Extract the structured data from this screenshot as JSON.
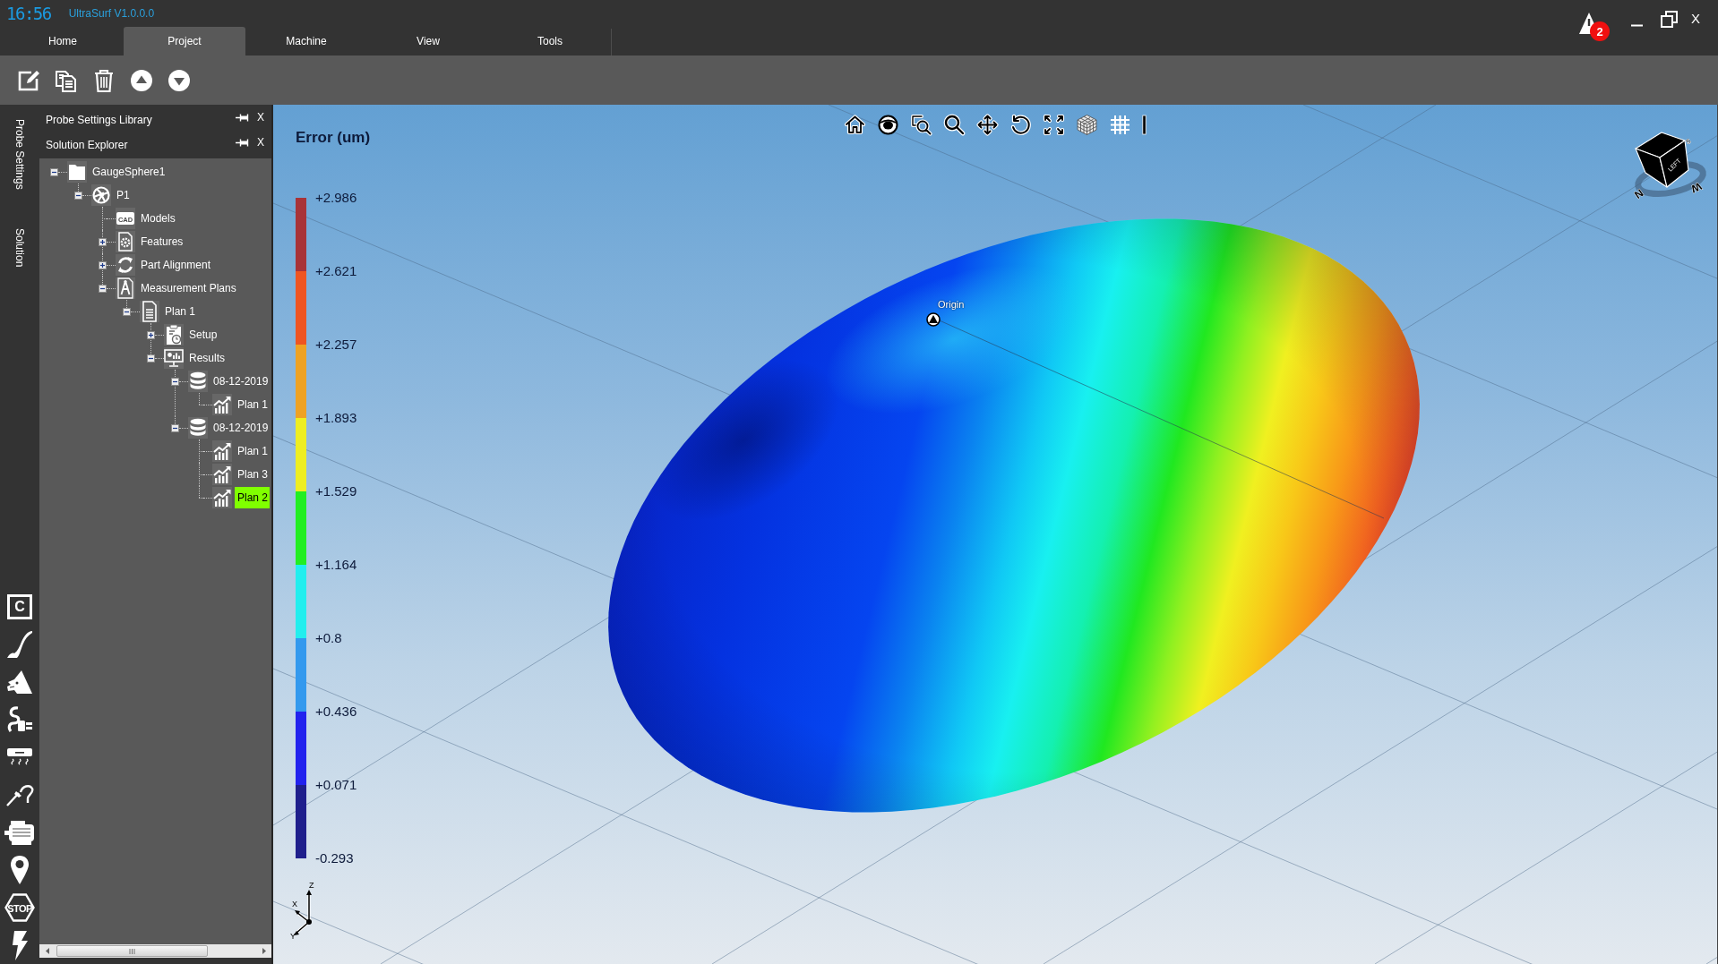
{
  "title_bar": {
    "clock": "16:56",
    "app_name": "UltraSurf V1.0.0.0",
    "alert_count": "2",
    "close_label": "X"
  },
  "ribbon_tabs": [
    {
      "label": "Home",
      "selected": false
    },
    {
      "label": "Project",
      "selected": true
    },
    {
      "label": "Machine",
      "selected": false
    },
    {
      "label": "View",
      "selected": false
    },
    {
      "label": "Tools",
      "selected": false
    }
  ],
  "side_tabs": [
    "Probe Settings",
    "Solution"
  ],
  "tool_strip": [
    {
      "kind": "letter",
      "label": "C"
    },
    {
      "kind": "brush"
    },
    {
      "kind": "wolf"
    },
    {
      "kind": "plug"
    },
    {
      "kind": "heater"
    },
    {
      "kind": "probe"
    },
    {
      "kind": "motor"
    },
    {
      "kind": "pin"
    },
    {
      "kind": "stop",
      "label": "STOP"
    },
    {
      "kind": "bolt"
    }
  ],
  "dock_panels": [
    {
      "title": "Probe Settings Library",
      "close_label": "X"
    },
    {
      "title": "Solution Explorer",
      "close_label": "X"
    }
  ],
  "solution_tree": [
    {
      "label": "GaugeSphere1",
      "kind": "folder",
      "expanded": true,
      "selected": false,
      "children": [
        {
          "label": "P1",
          "kind": "part",
          "expanded": true,
          "selected": false,
          "children": [
            {
              "label": "Models",
              "kind": "models",
              "icon_text": "CAD",
              "selected": false
            },
            {
              "label": "Features",
              "kind": "features",
              "expanded": false,
              "selected": false
            },
            {
              "label": "Part Alignment",
              "kind": "alignment",
              "expanded": false,
              "selected": false
            },
            {
              "label": "Measurement Plans",
              "kind": "plans",
              "expanded": true,
              "selected": false,
              "children": [
                {
                  "label": "Plan 1",
                  "kind": "plan",
                  "expanded": true,
                  "selected": false,
                  "children": [
                    {
                      "label": "Setup",
                      "kind": "setup",
                      "expanded": false,
                      "selected": false
                    },
                    {
                      "label": "Results",
                      "kind": "results",
                      "expanded": true,
                      "selected": false,
                      "children": [
                        {
                          "label": "08-12-2019",
                          "kind": "dataset",
                          "expanded": true,
                          "selected": false,
                          "children": [
                            {
                              "label": "Plan 1",
                              "kind": "report",
                              "selected": false
                            }
                          ]
                        },
                        {
                          "label": "08-12-2019",
                          "kind": "dataset",
                          "expanded": true,
                          "selected": false,
                          "children": [
                            {
                              "label": "Plan 1",
                              "kind": "report",
                              "selected": false
                            },
                            {
                              "label": "Plan 3",
                              "kind": "report",
                              "selected": false
                            },
                            {
                              "label": "Plan 2",
                              "kind": "report",
                              "selected": true
                            }
                          ]
                        }
                      ]
                    }
                  ]
                }
              ]
            }
          ]
        }
      ]
    }
  ],
  "viewport": {
    "legend": {
      "title": "Error (um)",
      "labels": [
        "+2.986",
        "+2.621",
        "+2.257",
        "+1.893",
        "+1.529",
        "+1.164",
        "+0.8",
        "+0.436",
        "+0.071",
        "-0.293"
      ],
      "bands": [
        {
          "color": "#a83338"
        },
        {
          "color": "#ee5522"
        },
        {
          "color": "#eea224"
        },
        {
          "color": "#eeee22"
        },
        {
          "color": "#22ee22"
        },
        {
          "color": "#22eeee"
        },
        {
          "color": "#3399ee"
        },
        {
          "color": "#2222ee"
        },
        {
          "color": "#1f1f8c"
        }
      ]
    },
    "origin_label": "Origin",
    "view_cube": {
      "face_label": "LEFT",
      "compass": [
        "S",
        "W",
        "N"
      ]
    },
    "axis_labels": [
      "Z",
      "X",
      "Y"
    ]
  }
}
